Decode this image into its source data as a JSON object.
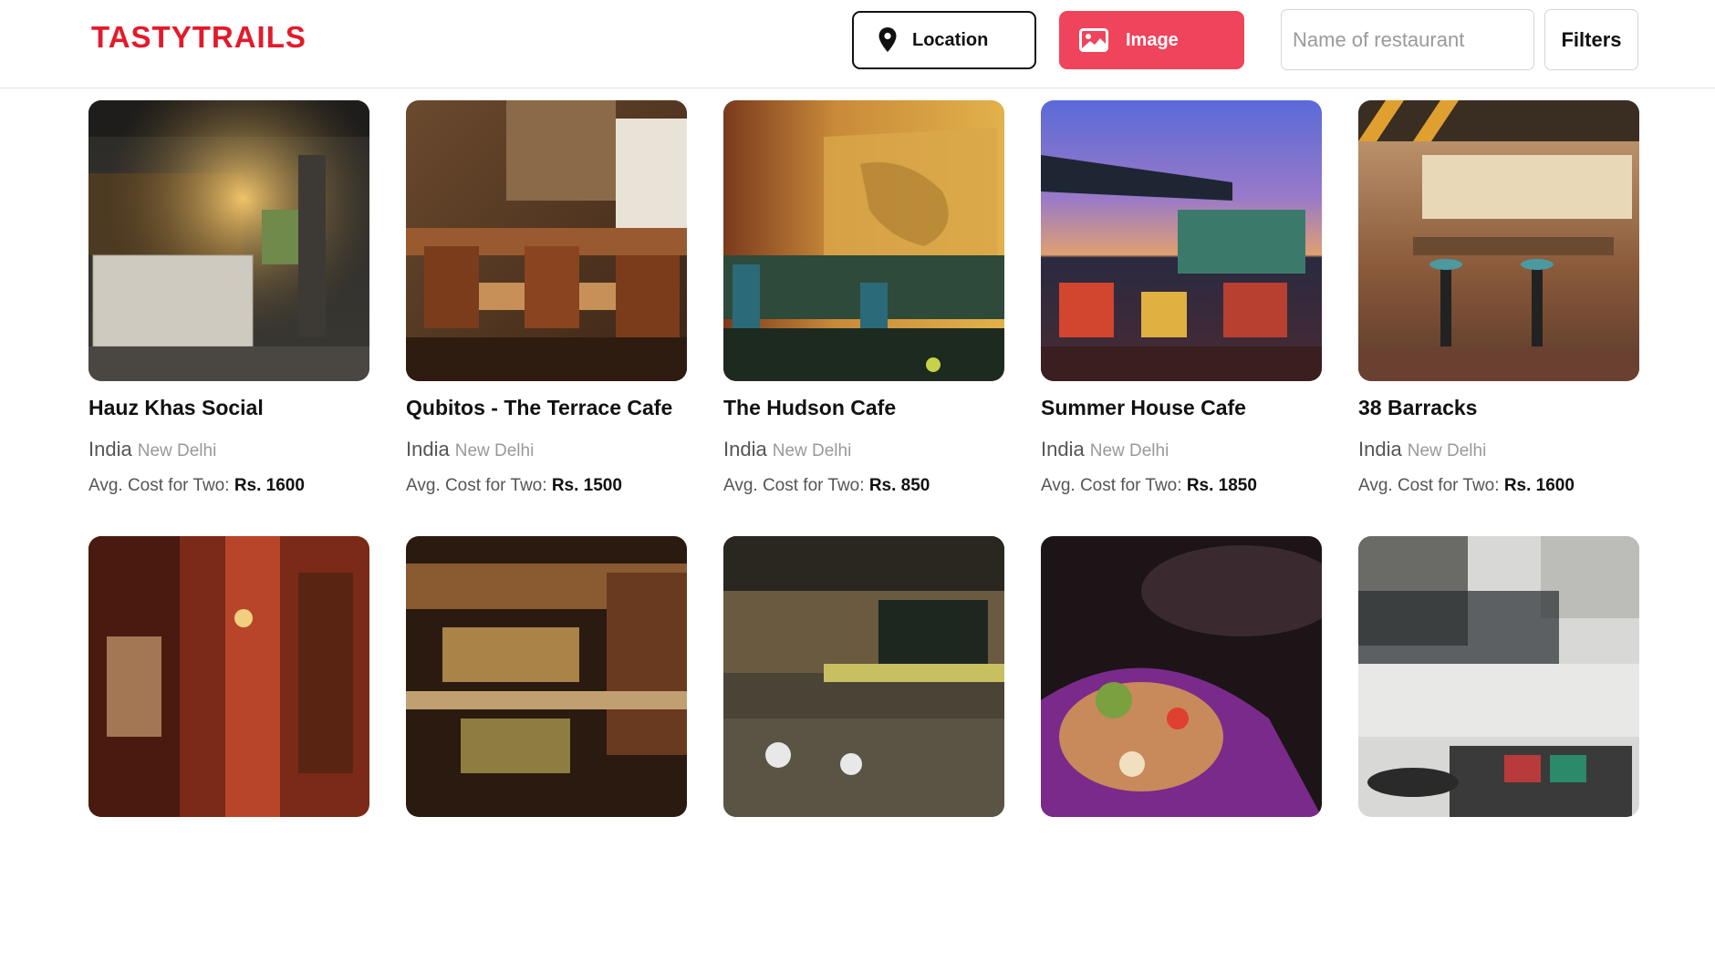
{
  "header": {
    "logo": "TASTYTRAILS",
    "location_label": "Location",
    "image_label": "Image",
    "search_placeholder": "Name of restaurant",
    "filters_label": "Filters"
  },
  "colors": {
    "brand": "#e21b2b",
    "accent": "#f0435c"
  },
  "icons": {
    "location": "map-pin-icon",
    "image": "image-icon"
  },
  "restaurants": [
    {
      "name": "Hauz Khas Social",
      "country": "India",
      "city": "New Delhi",
      "cost_label": "Avg. Cost for Two:",
      "cost": "Rs. 1600"
    },
    {
      "name": "Qubitos - The Terrace Cafe",
      "country": "India",
      "city": "New Delhi",
      "cost_label": "Avg. Cost for Two:",
      "cost": "Rs. 1500"
    },
    {
      "name": "The Hudson Cafe",
      "country": "India",
      "city": "New Delhi",
      "cost_label": "Avg. Cost for Two:",
      "cost": "Rs. 850"
    },
    {
      "name": "Summer House Cafe",
      "country": "India",
      "city": "New Delhi",
      "cost_label": "Avg. Cost for Two:",
      "cost": "Rs. 1850"
    },
    {
      "name": "38 Barracks",
      "country": "India",
      "city": "New Delhi",
      "cost_label": "Avg. Cost for Two:",
      "cost": "Rs. 1600"
    },
    {
      "name": "",
      "country": "",
      "city": "",
      "cost_label": "",
      "cost": ""
    },
    {
      "name": "",
      "country": "",
      "city": "",
      "cost_label": "",
      "cost": ""
    },
    {
      "name": "",
      "country": "",
      "city": "",
      "cost_label": "",
      "cost": ""
    },
    {
      "name": "",
      "country": "",
      "city": "",
      "cost_label": "",
      "cost": ""
    },
    {
      "name": "",
      "country": "",
      "city": "",
      "cost_label": "",
      "cost": ""
    }
  ]
}
